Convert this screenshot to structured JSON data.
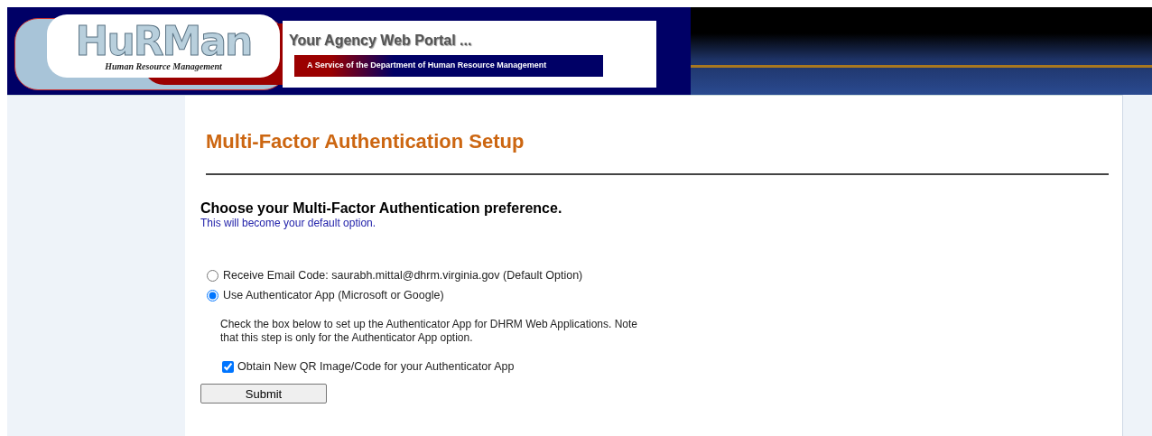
{
  "header": {
    "logo_title": "HuRMan",
    "logo_subtitle": "Human Resource Management",
    "portal_title": "Your Agency Web Portal ...",
    "service_text": "A Service of the Department of Human Resource Management"
  },
  "page_title": "Multi-Factor Authentication Setup",
  "prompt": {
    "heading": "Choose your Multi-Factor Authentication preference.",
    "note": "This will become your default option."
  },
  "options": [
    {
      "label": "Receive Email Code: saurabh.mittal@dhrm.virginia.gov (Default Option)",
      "selected": false
    },
    {
      "label": "Use Authenticator App (Microsoft or Google)",
      "selected": true
    }
  ],
  "instructions": "Check the box below to set up the Authenticator App for DHRM Web Applications. Note that this step is only for the Authenticator App option.",
  "qr_checkbox": {
    "label": "Obtain New QR Image/Code for your Authenticator App",
    "checked": true
  },
  "buttons": [
    "Submit"
  ]
}
